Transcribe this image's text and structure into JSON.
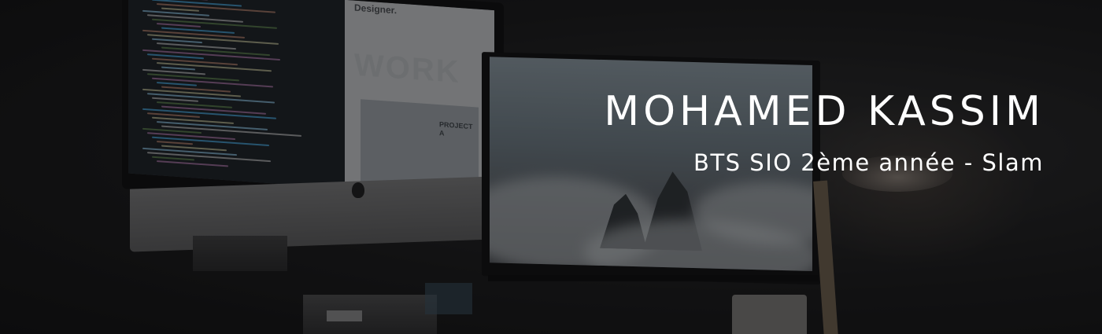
{
  "hero": {
    "name": "MOHAMED KASSIM",
    "subtitle": "BTS SIO 2ème année - Slam"
  },
  "background_photo": {
    "imac_site_heading": "Designer.",
    "imac_site_watermark": "WORK",
    "imac_project_label": "PROJECT A"
  },
  "colors": {
    "text": "#ffffff",
    "overlay": "#0c0c0e",
    "background": "#151515"
  }
}
